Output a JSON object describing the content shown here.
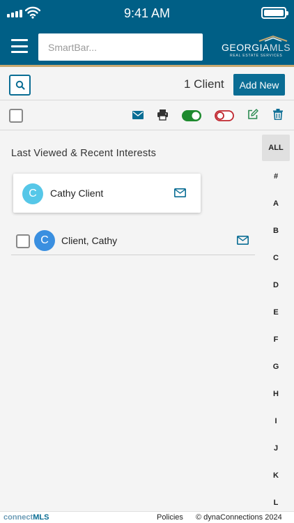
{
  "status_bar": {
    "time": "9:41 AM"
  },
  "header": {
    "smartbar_placeholder": "SmartBar...",
    "logo": {
      "main": "GEORGIA",
      "accent": "MLS",
      "sub": "REAL ESTATE SERVICES"
    }
  },
  "toolbar": {
    "client_count": "1 Client",
    "add_new_label": "Add New"
  },
  "section": {
    "title": "Last Viewed & Recent Interests"
  },
  "recent_card": {
    "avatar": "C",
    "name": "Cathy Client"
  },
  "client_list": [
    {
      "avatar": "C",
      "name": "Client, Cathy"
    }
  ],
  "alphabet": {
    "all": "ALL",
    "letters": [
      "#",
      "A",
      "B",
      "C",
      "D",
      "E",
      "F",
      "G",
      "H",
      "I",
      "J",
      "K",
      "L"
    ]
  },
  "footer": {
    "brand_part1": "connect",
    "brand_part2": "MLS",
    "policies": "Policies",
    "copyright": "© dynaConnections 2024"
  },
  "colors": {
    "brand_blue": "#005f86",
    "accent_blue": "#0a6d94",
    "toggle_on": "#1e8a2e",
    "toggle_off": "#c0262e",
    "edit_green": "#2a8a50",
    "avatar_light": "#56c7e8",
    "avatar_dark": "#3a8fe0"
  }
}
